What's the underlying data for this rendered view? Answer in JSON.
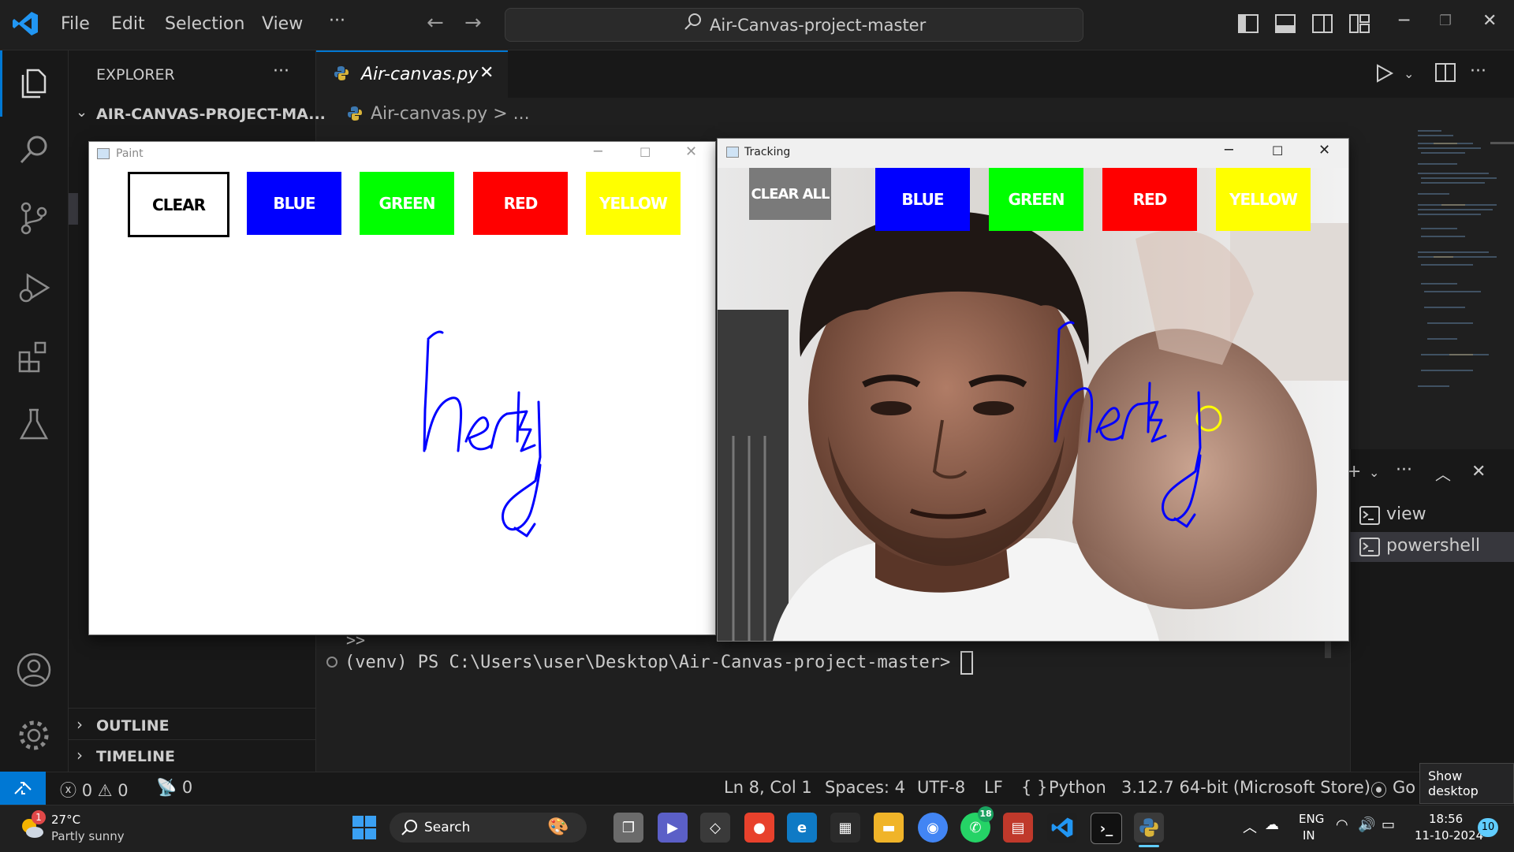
{
  "menu": {
    "file": "File",
    "edit": "Edit",
    "selection": "Selection",
    "view": "View",
    "more": "···"
  },
  "command_center": {
    "text": "Air-Canvas-project-master"
  },
  "sidebar": {
    "title": "EXPLORER",
    "more": "···",
    "project": "AIR-CANVAS-PROJECT-MA...",
    "outline": "OUTLINE",
    "timeline": "TIMELINE"
  },
  "editor": {
    "tab_label": "Air-canvas.py",
    "breadcrumb_file": "Air-canvas.py",
    "breadcrumb_sep": ">",
    "breadcrumb_more": "..."
  },
  "terminal": {
    "continuation": ">>",
    "prompt": "(venv) PS C:\\Users\\user\\Desktop\\Air-Canvas-project-master>",
    "sessions": [
      {
        "label": "view"
      },
      {
        "label": "powershell"
      }
    ]
  },
  "paint_window": {
    "title": "Paint",
    "buttons": [
      {
        "label": "CLEAR",
        "color": "#ffffff",
        "text_color": "#000000"
      },
      {
        "label": "BLUE",
        "color": "#0000ff",
        "text_color": "#ffffff"
      },
      {
        "label": "GREEN",
        "color": "#00ff00",
        "text_color": "#ffffff"
      },
      {
        "label": "RED",
        "color": "#ff0000",
        "text_color": "#ffffff"
      },
      {
        "label": "YELLOW",
        "color": "#ffff00",
        "text_color": "#ffffff"
      }
    ],
    "stroke_color": "#0000ff"
  },
  "tracking_window": {
    "title": "Tracking",
    "buttons": [
      {
        "label": "CLEAR ALL",
        "color": "#7a7a7a",
        "text_color": "#ffffff"
      },
      {
        "label": "BLUE",
        "color": "#0000ff",
        "text_color": "#ffffff"
      },
      {
        "label": "GREEN",
        "color": "#00ff00",
        "text_color": "#ffffff"
      },
      {
        "label": "RED",
        "color": "#ff0000",
        "text_color": "#ffffff"
      },
      {
        "label": "YELLOW",
        "color": "#ffff00",
        "text_color": "#ffffff"
      }
    ]
  },
  "statusbar": {
    "errors": "0",
    "warnings": "0",
    "ports": "0",
    "position": "Ln 8, Col 1",
    "spaces": "Spaces: 4",
    "encoding": "UTF-8",
    "eol": "LF",
    "language": "Python",
    "interpreter": "3.12.7 64-bit (Microsoft Store)",
    "golive": "Go Live",
    "tooltip": "Show desktop"
  },
  "taskbar": {
    "weather_temp": "27°C",
    "weather_desc": "Partly sunny",
    "weather_badge": "1",
    "search": "Search",
    "whatsapp_badge": "18",
    "lang_top": "ENG",
    "lang_bottom": "IN",
    "time": "18:56",
    "date": "11-10-2024",
    "notif_count": "10"
  },
  "colors": {
    "accent": "#0078d4",
    "editor_bg": "#1f1f1f",
    "sidebar_bg": "#181818"
  }
}
